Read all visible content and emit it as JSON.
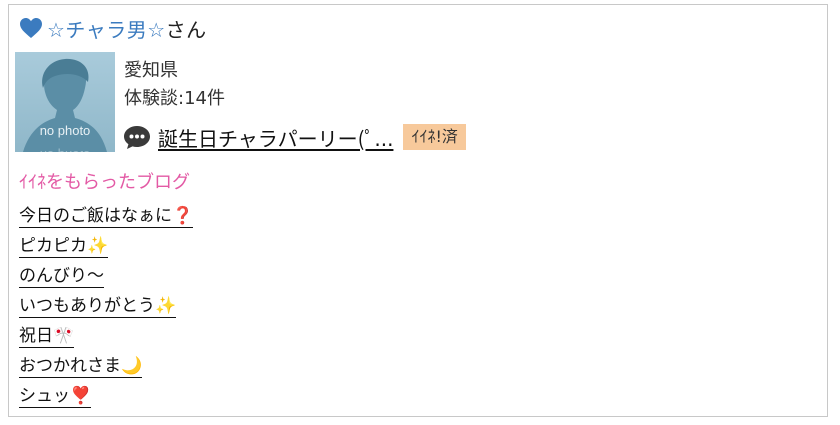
{
  "user": {
    "icon": "heart-icon",
    "icon_color": "#3b7bbf",
    "name": "☆チャラ男☆",
    "suffix": "さん"
  },
  "avatar": {
    "placeholder_text": "no photo",
    "bg_color": "#9ec3d4"
  },
  "profile": {
    "prefecture": "愛知県",
    "experience_count": "体験談:14件"
  },
  "latest_post": {
    "icon": "comment-icon",
    "title": "誕生日チャラパーリー(ﾟ...",
    "badge": "ｲｲﾈ!済",
    "badge_color": "#f7c99b"
  },
  "liked_blogs": {
    "title": "ｲｲﾈをもらったブログ",
    "title_color": "#e35aa5",
    "items": [
      {
        "text": "今日のご飯はなぁに❓"
      },
      {
        "text": "ピカピカ✨"
      },
      {
        "text": "のんびり〜"
      },
      {
        "text": "いつもありがとう✨"
      },
      {
        "text": "祝日🎌"
      },
      {
        "text": "おつかれさま🌙"
      },
      {
        "text": "シュッ❣️"
      }
    ]
  }
}
